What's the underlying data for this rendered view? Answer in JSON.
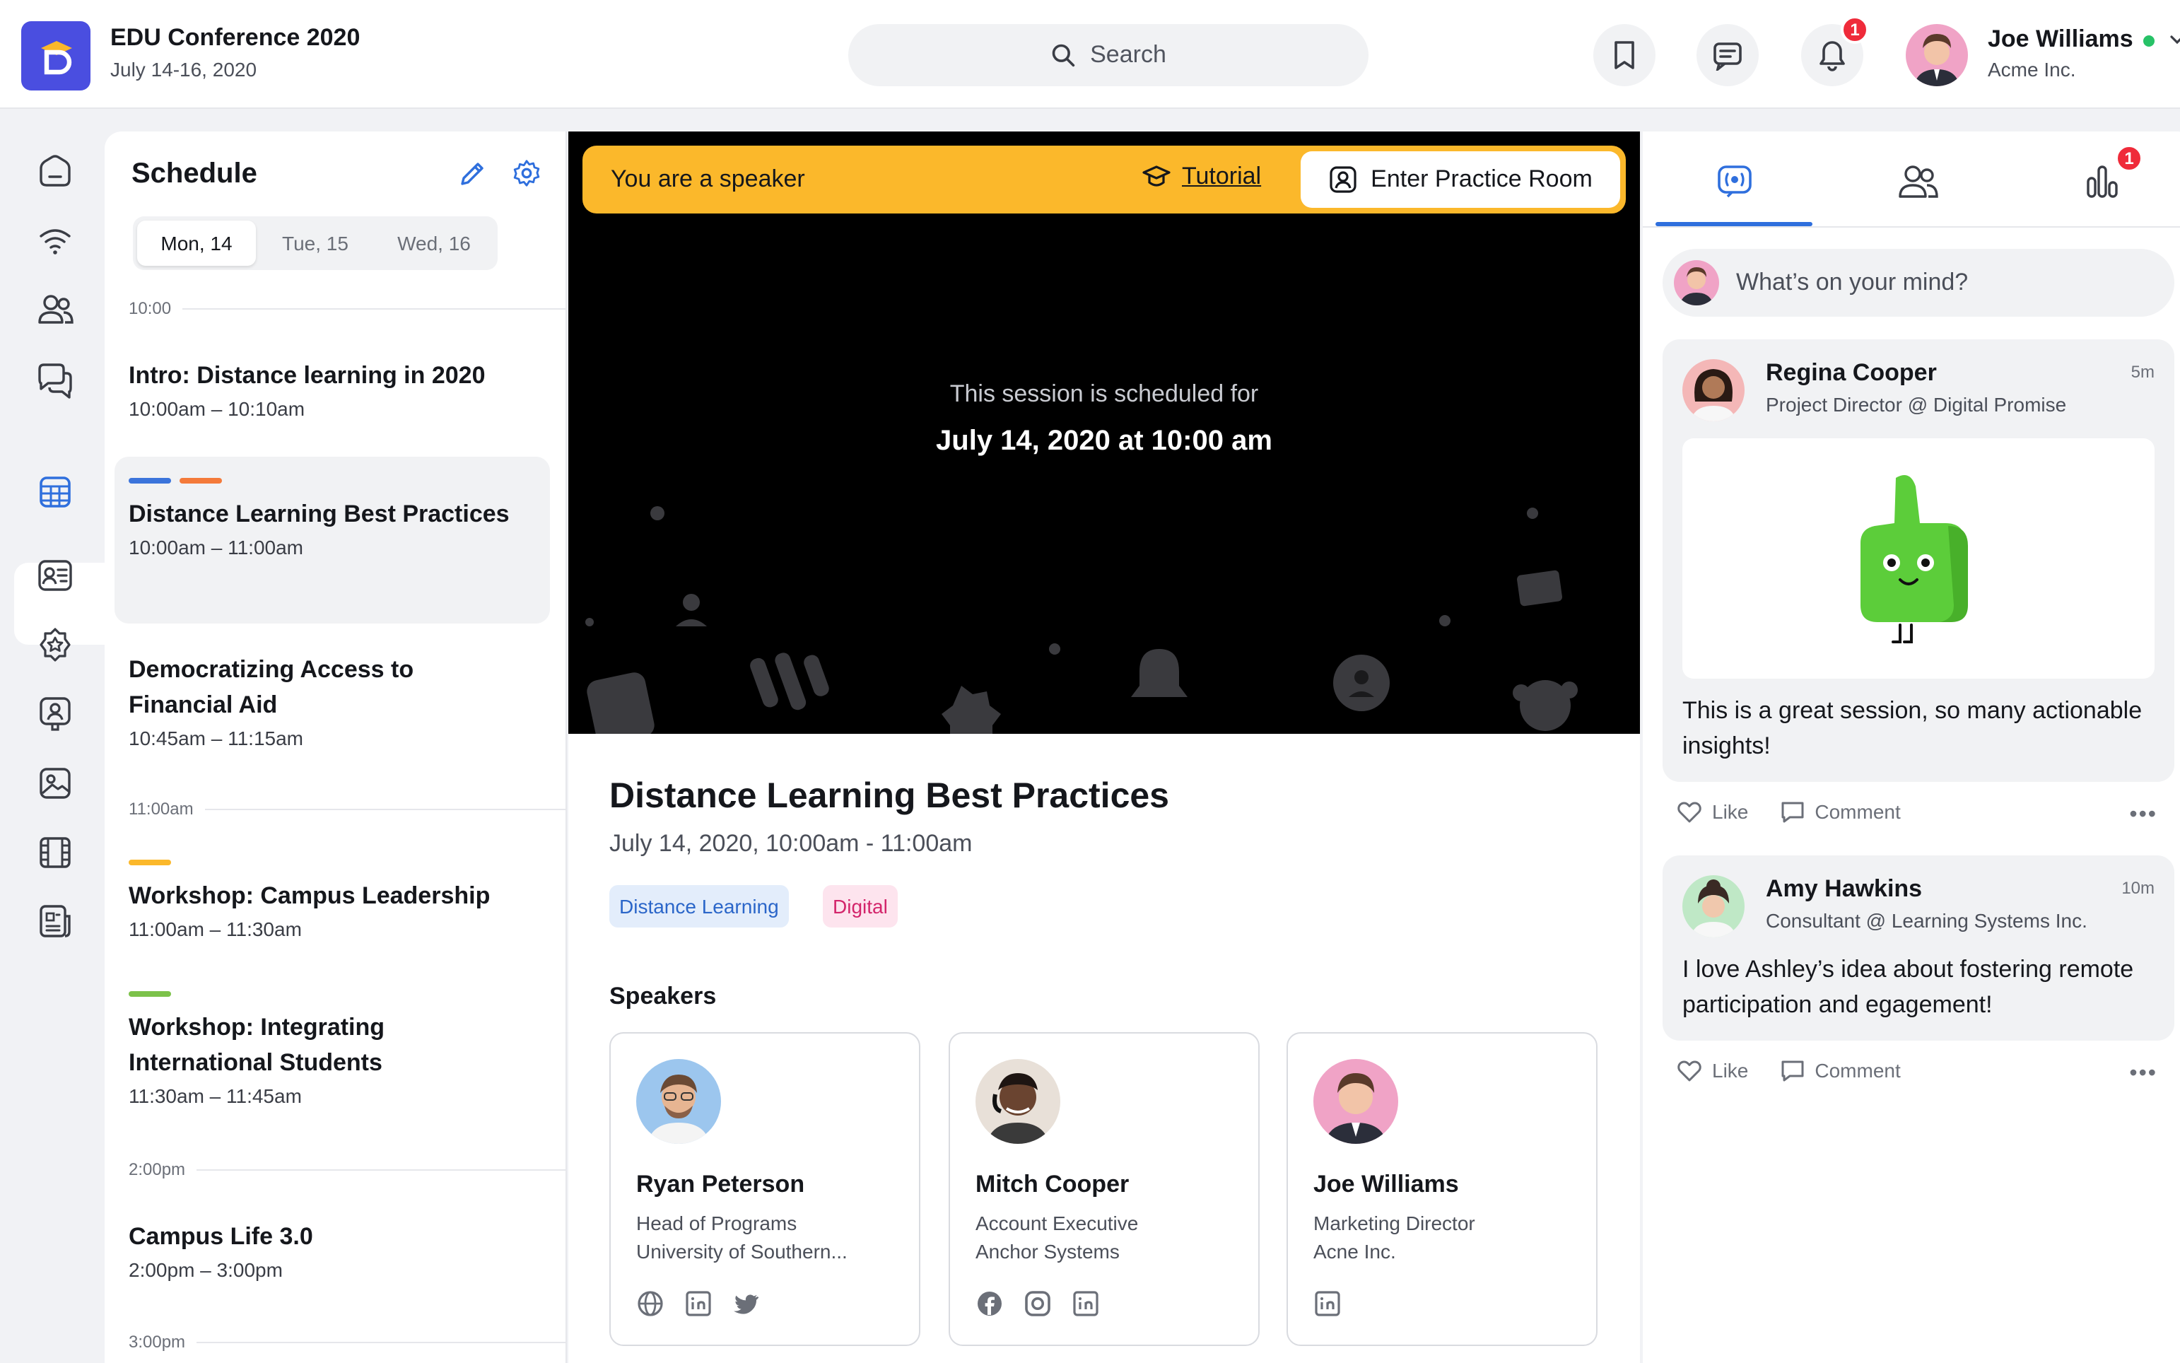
{
  "header": {
    "title": "EDU Conference 2020",
    "subtitle": "July 14-16, 2020",
    "search_placeholder": "Search",
    "notifications_count": "1",
    "user_name": "Joe Williams",
    "user_org": "Acme Inc."
  },
  "schedule": {
    "title": "Schedule",
    "days": [
      "Mon, 14",
      "Tue, 15",
      "Wed, 16"
    ],
    "selected_day": "Mon, 14",
    "times": [
      "10:00",
      "11:00am",
      "2:00pm",
      "3:00pm"
    ],
    "sessions": [
      {
        "title": "Intro: Distance learning in 2020",
        "time": "10:00am – 10:10am"
      },
      {
        "title": "Distance Learning Best Practices",
        "time": "10:00am – 11:00am"
      },
      {
        "title": "Democratizing Access to Financial Aid",
        "time": "10:45am – 11:15am"
      },
      {
        "title": "Workshop: Campus Leadership",
        "time": "11:00am – 11:30am"
      },
      {
        "title": "Workshop: Integrating International Students",
        "time": "11:30am – 11:45am"
      },
      {
        "title": "Campus Life 3.0",
        "time": "2:00pm – 3:00pm"
      }
    ]
  },
  "stage": {
    "speaker_label": "You are a speaker",
    "tutorial_label": "Tutorial",
    "practice_label": "Enter Practice Room",
    "scheduled_note": "This session is scheduled for",
    "scheduled_date": "July 14, 2020 at 10:00 am"
  },
  "session": {
    "title": "Distance Learning Best Practices",
    "date": "July 14, 2020, 10:00am - 11:00am",
    "tags": [
      "Distance Learning",
      "Digital"
    ],
    "speakers_heading": "Speakers",
    "speakers": [
      {
        "name": "Ryan Peterson",
        "role": "Head of Programs",
        "org": "University of Southern..."
      },
      {
        "name": "Mitch Cooper",
        "role": "Account Executive",
        "org": "Anchor Systems"
      },
      {
        "name": "Joe Williams",
        "role": "Marketing Director",
        "org": "Acne Inc."
      }
    ]
  },
  "feed": {
    "stats_badge": "1",
    "composer_placeholder": "What’s on your mind?",
    "like_label": "Like",
    "comment_label": "Comment",
    "posts": [
      {
        "name": "Regina Cooper",
        "role": "Project Director @ Digital Promise",
        "time": "5m",
        "text": "This is a great session, so many actionable insights!"
      },
      {
        "name": "Amy Hawkins",
        "role": "Consultant @ Learning Systems Inc.",
        "time": "10m",
        "text": "I love Ashley’s idea about fostering remote participation and egagement!"
      }
    ]
  },
  "colors": {
    "brand": "#4a4ee0",
    "speaker_bar": "#fbb82b",
    "accent": "#2f6fdd",
    "badge": "#ef2b3a"
  }
}
